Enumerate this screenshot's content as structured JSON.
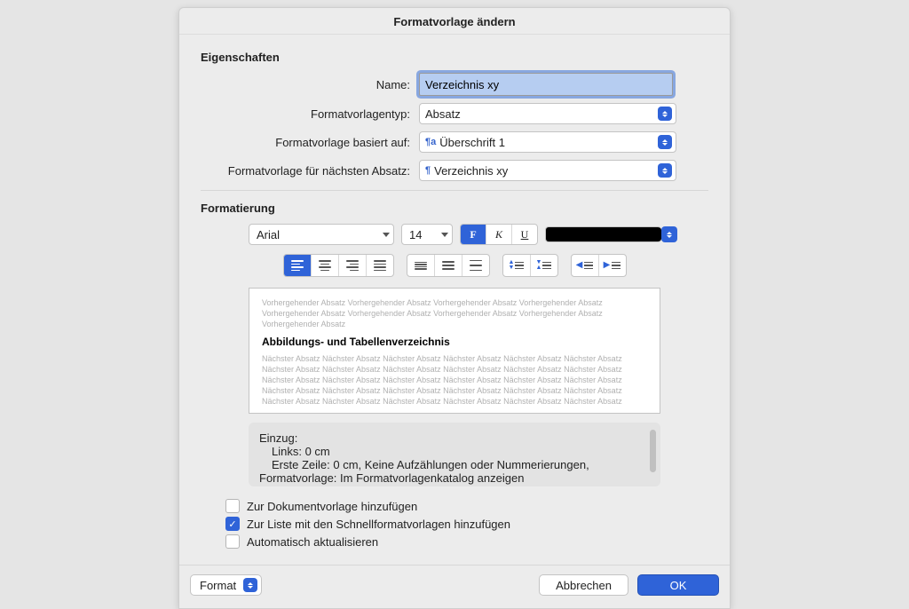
{
  "title": "Formatvorlage ändern",
  "properties": {
    "section": "Eigenschaften",
    "name_label": "Name:",
    "name_value": "Verzeichnis xy",
    "type_label": "Formatvorlagentyp:",
    "type_value": "Absatz",
    "based_on_label": "Formatvorlage basiert auf:",
    "based_on_value": "Überschrift 1",
    "based_on_icon": "¶a",
    "next_label": "Formatvorlage für nächsten Absatz:",
    "next_value": "Verzeichnis xy",
    "next_icon": "¶"
  },
  "formatting": {
    "section": "Formatierung",
    "font_value": "Arial",
    "size_value": "14",
    "bold_label": "F",
    "italic_label": "K",
    "underline_label": "U",
    "color_value": "#000000"
  },
  "preview": {
    "prev_text": "Vorhergehender Absatz Vorhergehender Absatz Vorhergehender Absatz Vorhergehender Absatz Vorhergehender Absatz Vorhergehender Absatz Vorhergehender Absatz Vorhergehender Absatz Vorhergehender Absatz",
    "sample_heading": "Abbildungs- und Tabellenverzeichnis",
    "next_text": "Nächster Absatz Nächster Absatz Nächster Absatz Nächster Absatz Nächster Absatz Nächster Absatz Nächster Absatz Nächster Absatz Nächster Absatz Nächster Absatz Nächster Absatz Nächster Absatz Nächster Absatz Nächster Absatz Nächster Absatz Nächster Absatz Nächster Absatz Nächster Absatz Nächster Absatz Nächster Absatz Nächster Absatz Nächster Absatz Nächster Absatz Nächster Absatz Nächster Absatz Nächster Absatz Nächster Absatz Nächster Absatz Nächster Absatz Nächster Absatz"
  },
  "description": {
    "l1": "Einzug:",
    "l2": "Links:  0 cm",
    "l3": "Erste Zeile:  0 cm,  Keine Aufzählungen oder Nummerierungen,",
    "l4": "Formatvorlage: Im Formatvorlagenkatalog anzeigen"
  },
  "checks": {
    "add_template": "Zur Dokumentvorlage hinzufügen",
    "add_quickstyles": "Zur Liste mit den Schnellformatvorlagen hinzufügen",
    "auto_update": "Automatisch aktualisieren",
    "add_template_checked": false,
    "add_quickstyles_checked": true,
    "auto_update_checked": false
  },
  "footer": {
    "format": "Format",
    "cancel": "Abbrechen",
    "ok": "OK"
  }
}
